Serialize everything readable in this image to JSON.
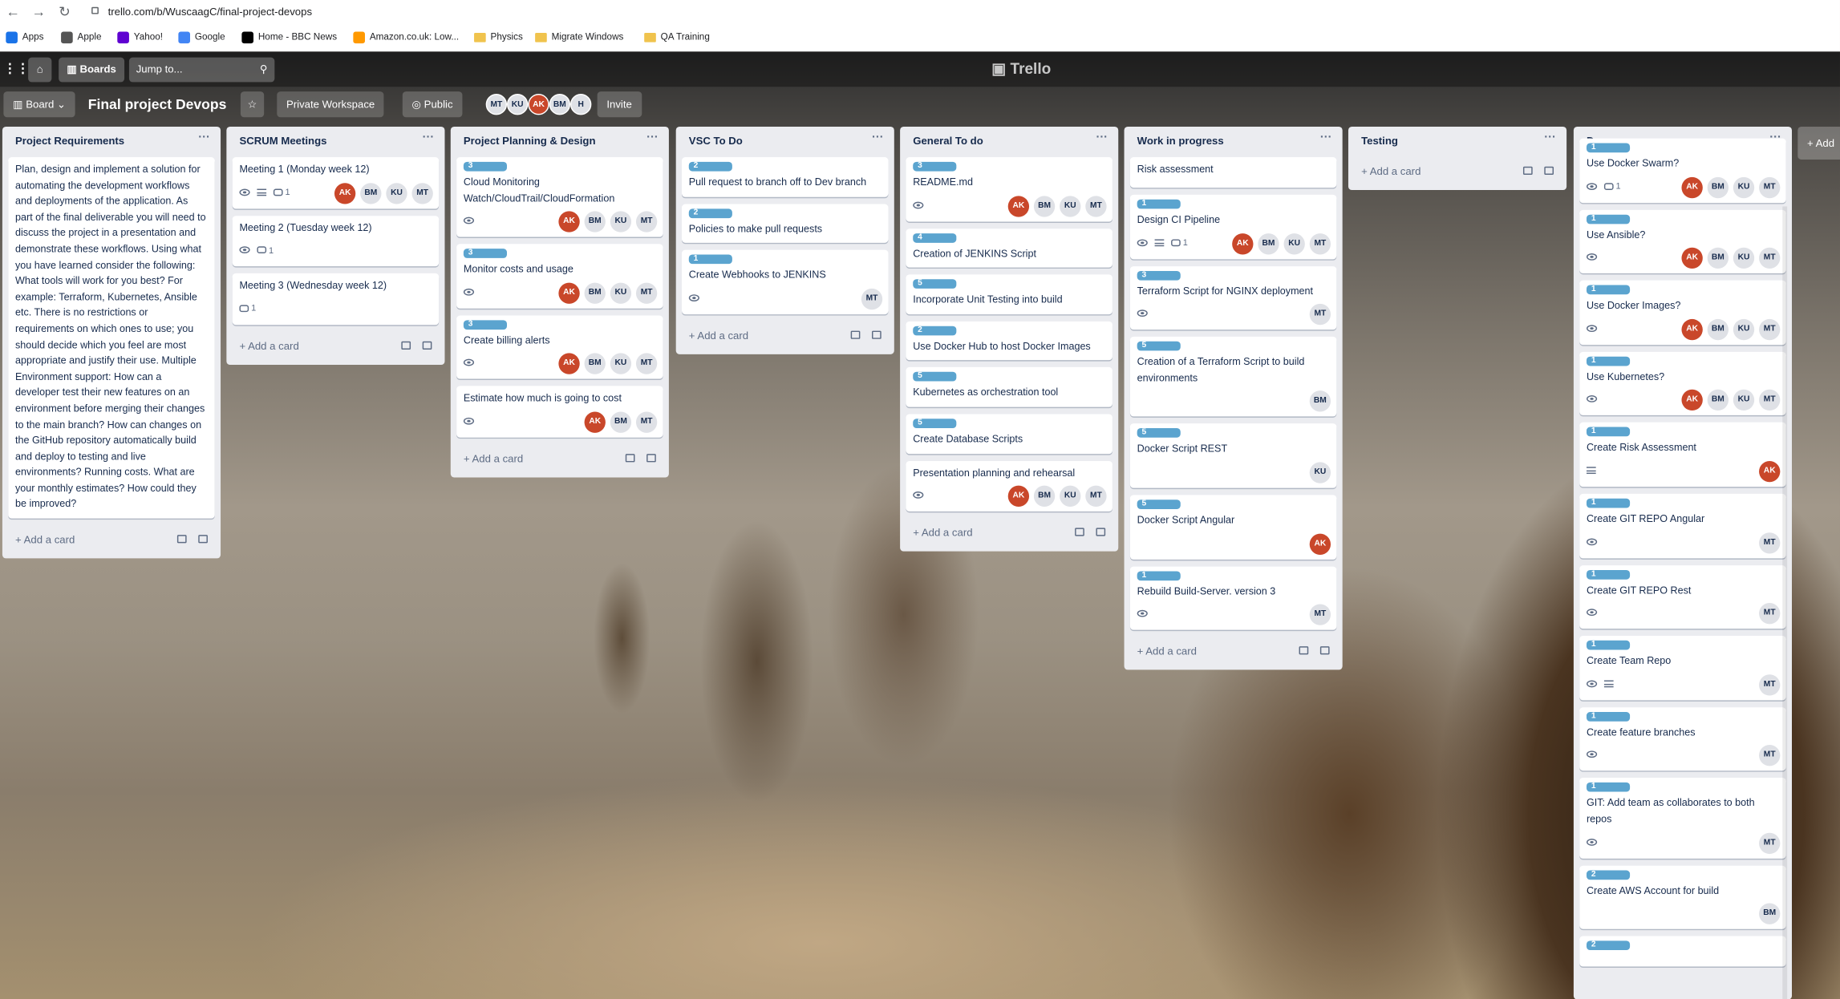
{
  "browser": {
    "url": "trello.com/b/WuscaagC/final-project-devops"
  },
  "bookmarks": [
    {
      "label": "Apps",
      "icon": "apps-grid-icon",
      "color": "#1a73e8"
    },
    {
      "label": "Apple",
      "icon": "apple-icon",
      "color": "#555555"
    },
    {
      "label": "Yahoo!",
      "icon": "yahoo-icon",
      "color": "#5f01d1"
    },
    {
      "label": "Google",
      "icon": "google-icon",
      "color": "#4285f4"
    },
    {
      "label": "Home - BBC News",
      "icon": "bbc-icon",
      "color": "#000000"
    },
    {
      "label": "Amazon.co.uk: Low...",
      "icon": "amazon-icon",
      "color": "#ff9900"
    },
    {
      "label": "Physics",
      "icon": "folder-icon"
    },
    {
      "label": "Migrate Windows",
      "icon": "folder-icon"
    },
    {
      "label": "QA Training",
      "icon": "folder-icon"
    }
  ],
  "header": {
    "boards": "Boards",
    "search_placeholder": "Jump to...",
    "logo": "Trello"
  },
  "boardbar": {
    "view": "Board",
    "title": "Final project Devops",
    "workspace": "Private Workspace",
    "visibility": "Public",
    "invite": "Invite",
    "members": [
      "MT",
      "KU",
      "AK",
      "BM",
      "H"
    ]
  },
  "add_card": "Add a card",
  "add_list": "+ Add",
  "lists": [
    {
      "title": "Project Requirements",
      "cards": [
        {
          "title": "Plan, design and implement a solution for automating the development workflows and deployments of the application. As part of the final deliverable you will need to discuss the project in a presentation and demonstrate these workflows. Using what you have learned consider the following: What tools will work for you best? For example: Terraform, Kubernetes, Ansible etc. There is no restrictions or requirements on which ones to use; you should decide which you feel are most appropriate and justify their use. Multiple Environment support: How can a developer test their new features on an environment before merging their changes to the main branch? How can changes on the GitHub repository automatically build and deploy to testing and live environments? Running costs. What are your monthly estimates? How could they be improved?"
        }
      ]
    },
    {
      "title": "SCRUM Meetings",
      "cards": [
        {
          "title": "Meeting 1 (Monday week 12)",
          "watch": true,
          "desc": true,
          "comments": "1",
          "members": [
            "AK",
            "BM",
            "KU",
            "MT"
          ]
        },
        {
          "title": "Meeting 2 (Tuesday week 12)",
          "watch": true,
          "comments": "1"
        },
        {
          "title": "Meeting 3 (Wednesday week 12)",
          "comments": "1"
        }
      ]
    },
    {
      "title": "Project Planning & Design",
      "cards": [
        {
          "label": "3",
          "title": "Cloud Monitoring Watch/CloudTrail/CloudFormation",
          "watch": true,
          "members": [
            "AK",
            "BM",
            "KU",
            "MT"
          ]
        },
        {
          "label": "3",
          "title": "Monitor costs and usage",
          "watch": true,
          "members": [
            "AK",
            "BM",
            "KU",
            "MT"
          ]
        },
        {
          "label": "3",
          "title": "Create billing alerts",
          "watch": true,
          "members": [
            "AK",
            "BM",
            "KU",
            "MT"
          ]
        },
        {
          "title": "Estimate how much is going to cost",
          "watch": true,
          "members": [
            "AK",
            "BM",
            "MT"
          ]
        }
      ]
    },
    {
      "title": "VSC To Do",
      "cards": [
        {
          "label": "2",
          "title": "Pull request to branch off to Dev branch"
        },
        {
          "label": "2",
          "title": "Policies to make pull requests"
        },
        {
          "label": "1",
          "title": "Create Webhooks to JENKINS",
          "watch": true,
          "members": [
            "MT"
          ]
        }
      ]
    },
    {
      "title": "General To do",
      "cards": [
        {
          "label": "3",
          "title": "README.md",
          "watch": true,
          "members": [
            "AK",
            "BM",
            "KU",
            "MT"
          ]
        },
        {
          "label": "4",
          "title": "Creation of JENKINS Script"
        },
        {
          "label": "5",
          "title": "Incorporate Unit Testing into build"
        },
        {
          "label": "2",
          "title": "Use Docker Hub to host Docker Images"
        },
        {
          "label": "5",
          "title": "Kubernetes as orchestration tool"
        },
        {
          "label": "5",
          "title": "Create Database Scripts"
        },
        {
          "title": "Presentation planning and rehearsal",
          "watch": true,
          "members": [
            "AK",
            "BM",
            "KU",
            "MT"
          ]
        }
      ]
    },
    {
      "title": "Work in progress",
      "cards": [
        {
          "title": "Risk assessment"
        },
        {
          "label": "1",
          "title": "Design CI Pipeline",
          "watch": true,
          "desc": true,
          "comments": "1",
          "members": [
            "AK",
            "BM",
            "KU",
            "MT"
          ]
        },
        {
          "label": "3",
          "title": "Terraform Script for NGINX deployment",
          "watch": true,
          "members": [
            "MT"
          ]
        },
        {
          "label": "5",
          "title": "Creation of a Terraform Script to build environments",
          "members": [
            "BM"
          ]
        },
        {
          "label": "5",
          "title": "Docker Script REST",
          "members": [
            "KU"
          ]
        },
        {
          "label": "5",
          "title": "Docker Script Angular",
          "members": [
            "AK"
          ]
        },
        {
          "label": "1",
          "title": "Rebuild Build-Server. version 3",
          "watch": true,
          "members": [
            "MT"
          ]
        }
      ]
    },
    {
      "title": "Testing",
      "cards": []
    },
    {
      "title": "Done",
      "cards": [
        {
          "label": "1",
          "title": "Use Docker Swarm?",
          "watch": true,
          "comments": "1",
          "members": [
            "AK",
            "BM",
            "KU",
            "MT"
          ]
        },
        {
          "label": "1",
          "title": "Use Ansible?",
          "watch": true,
          "members": [
            "AK",
            "BM",
            "KU",
            "MT"
          ]
        },
        {
          "label": "1",
          "title": "Use Docker Images?",
          "watch": true,
          "members": [
            "AK",
            "BM",
            "KU",
            "MT"
          ]
        },
        {
          "label": "1",
          "title": "Use Kubernetes?",
          "watch": true,
          "members": [
            "AK",
            "BM",
            "KU",
            "MT"
          ]
        },
        {
          "label": "1",
          "title": "Create Risk Assessment",
          "desc": true,
          "members": [
            "AK"
          ]
        },
        {
          "label": "1",
          "title": "Create GIT REPO Angular",
          "watch": true,
          "members": [
            "MT"
          ]
        },
        {
          "label": "1",
          "title": "Create GIT REPO Rest",
          "watch": true,
          "members": [
            "MT"
          ]
        },
        {
          "label": "1",
          "title": "Create Team Repo",
          "watch": true,
          "desc": true,
          "members": [
            "MT"
          ]
        },
        {
          "label": "1",
          "title": "Create feature branches",
          "watch": true,
          "members": [
            "MT"
          ]
        },
        {
          "label": "1",
          "title": "GIT: Add team as collaborates to both repos",
          "watch": true,
          "members": [
            "MT"
          ]
        },
        {
          "label": "2",
          "title": "Create AWS Account for build",
          "members": [
            "BM"
          ]
        },
        {
          "label": "2",
          "title": ""
        }
      ]
    }
  ],
  "colors": {
    "label": "#5ba4cf",
    "ak_avatar": "#c9472a"
  }
}
